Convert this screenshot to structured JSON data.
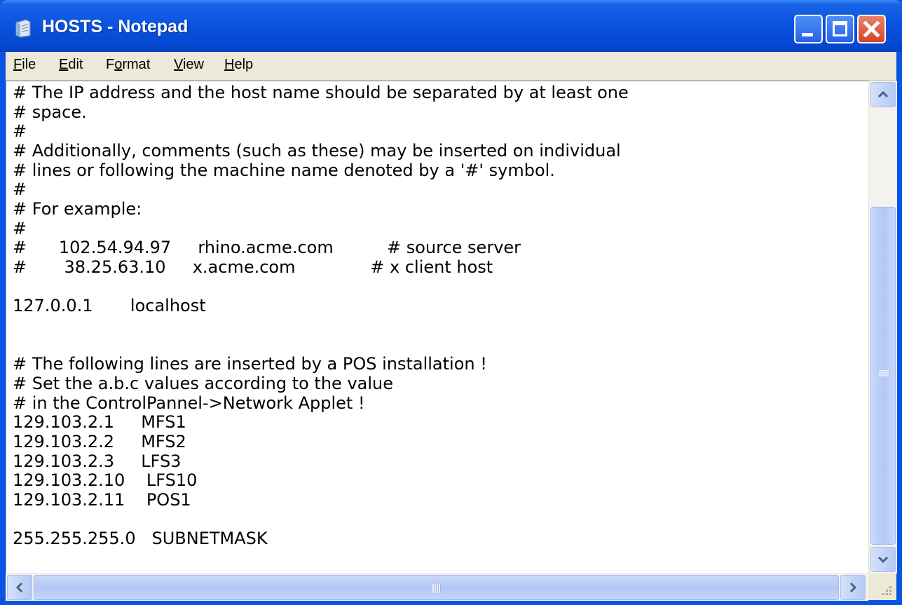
{
  "window": {
    "title": "HOSTS - Notepad"
  },
  "icons": {
    "app": "notepad-icon",
    "minimize": "minimize-icon",
    "maximize": "maximize-icon",
    "close": "close-icon",
    "scroll_up": "chevron-up-icon",
    "scroll_down": "chevron-down-icon",
    "scroll_left": "chevron-left-icon",
    "scroll_right": "chevron-right-icon",
    "resize": "resize-grip-icon"
  },
  "menu": {
    "items": [
      {
        "prefix": "",
        "key": "F",
        "rest": "ile"
      },
      {
        "prefix": "",
        "key": "E",
        "rest": "dit"
      },
      {
        "prefix": "F",
        "key": "o",
        "rest": "rmat"
      },
      {
        "prefix": "",
        "key": "V",
        "rest": "iew"
      },
      {
        "prefix": "",
        "key": "H",
        "rest": "elp"
      }
    ]
  },
  "document": {
    "lines": [
      "# The IP address and the host name should be separated by at least one",
      "# space.",
      "#",
      "# Additionally, comments (such as these) may be inserted on individual",
      "# lines or following the machine name denoted by a '#' symbol.",
      "#",
      "# For example:",
      "#",
      "#      102.54.94.97     rhino.acme.com          # source server",
      "#       38.25.63.10     x.acme.com              # x client host",
      "",
      "127.0.0.1       localhost",
      "",
      "",
      "# The following lines are inserted by a POS installation !",
      "# Set the a.b.c values according to the value",
      "# in the ControlPannel->Network Applet !",
      "129.103.2.1     MFS1",
      "129.103.2.2     MFS2",
      "129.103.2.3     LFS3",
      "129.103.2.10    LFS10",
      "129.103.2.11    POS1",
      "",
      "255.255.255.0   SUBNETMASK"
    ]
  },
  "colors": {
    "title_bar": "#0a54e3",
    "close_button": "#d2452b",
    "menu_bar": "#ece9d8",
    "scrollbar_thumb": "#b2c8f6"
  }
}
